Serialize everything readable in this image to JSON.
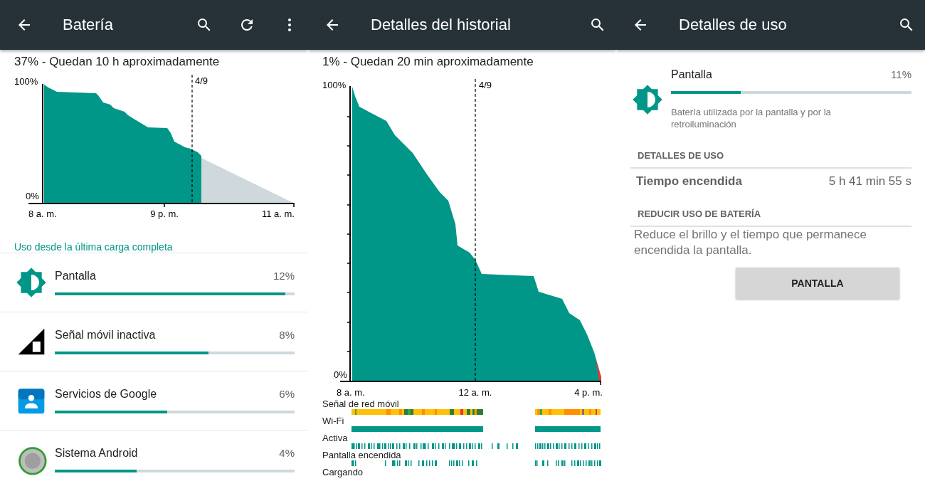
{
  "battery_screen": {
    "title": "Batería",
    "status": "37% - Quedan 10 h aproximadamente",
    "chart": {
      "y_max_label": "100%",
      "y_min_label": "0%",
      "marker_label": "4/9",
      "x_labels": [
        "8 a. m.",
        "9 p. m.",
        "11 a. m."
      ]
    },
    "section_link": "Uso desde la última carga completa",
    "items": [
      {
        "kind": "display",
        "name": "Pantalla",
        "percent": "12%",
        "level": 0.96
      },
      {
        "kind": "signal",
        "name": "Señal móvil inactiva",
        "percent": "8%",
        "level": 0.64
      },
      {
        "kind": "google",
        "name": "Servicios de Google",
        "percent": "6%",
        "level": 0.47
      },
      {
        "kind": "android",
        "name": "Sistema Android",
        "percent": "4%",
        "level": 0.34
      }
    ]
  },
  "history_screen": {
    "title": "Detalles del historial",
    "status": "1% - Quedan 20 min aproximadamente",
    "chart": {
      "y_max_label": "100%",
      "y_min_label": "0%",
      "marker_label": "4/9",
      "x_labels": [
        "8 a. m.",
        "12 a. m.",
        "4 p. m."
      ]
    },
    "timelines": [
      {
        "kind": "signal",
        "label": "Señal de red móvil"
      },
      {
        "kind": "wifi",
        "label": "Wi-Fi"
      },
      {
        "kind": "active",
        "label": "Activa"
      },
      {
        "kind": "screen",
        "label": "Pantalla encendida"
      },
      {
        "kind": "charging",
        "label": "Cargando"
      }
    ]
  },
  "usage_screen": {
    "title": "Detalles de uso",
    "item": {
      "kind": "display",
      "name": "Pantalla",
      "percent": "11%",
      "level": 0.29,
      "description": "Batería utilizada por la pantalla y por la retroiluminación"
    },
    "details_heading": "DETALLES DE USO",
    "stat": {
      "label": "Tiempo encendida",
      "value": "5 h 41 min 55 s"
    },
    "tips_heading": "REDUCIR USO DE BATERÍA",
    "tip": "Reduce el brillo y el tiempo que permanece encendida la pantalla.",
    "button": "PANTALLA"
  }
}
